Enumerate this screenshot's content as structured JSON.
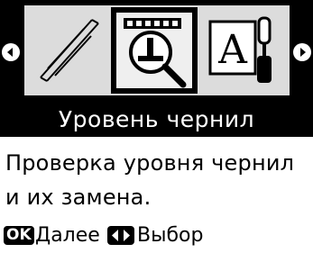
{
  "menu": {
    "icons": [
      {
        "name": "cleaning-icon",
        "selected": false
      },
      {
        "name": "ink-level-icon",
        "selected": true
      },
      {
        "name": "print-setup-icon",
        "selected": false
      }
    ],
    "title": "Уровень чернил",
    "description_line1": "Проверка уровня чернил",
    "description_line2": "и их замена."
  },
  "footer": {
    "ok_badge": "OK",
    "ok_label": "Далее",
    "select_label": "Выбор"
  }
}
